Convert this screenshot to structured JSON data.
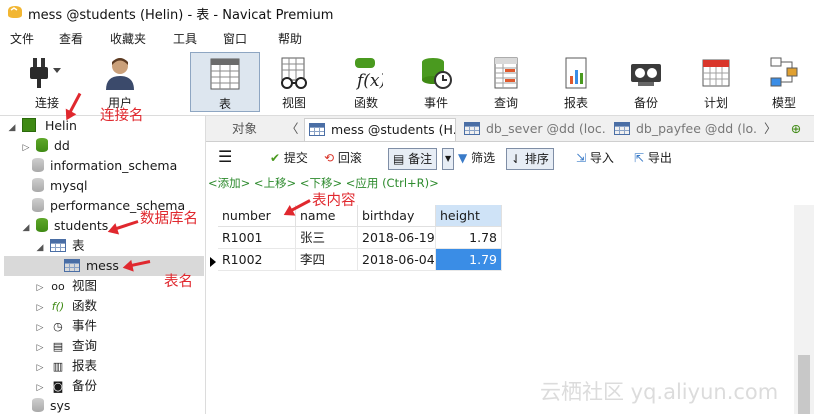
{
  "window": {
    "title": "mess @students (Helin) - 表 - Navicat Premium"
  },
  "menu": [
    "文件",
    "查看",
    "收藏夹",
    "工具",
    "窗口",
    "帮助"
  ],
  "toolbar": {
    "connect": "连接",
    "user": "用户",
    "table": "表",
    "view": "视图",
    "function": "函数",
    "event": "事件",
    "query": "查询",
    "report": "报表",
    "backup": "备份",
    "schedule": "计划",
    "model": "模型"
  },
  "tree": {
    "connection": "Helin",
    "databases": [
      "dd",
      "information_schema",
      "mysql",
      "performance_schema",
      "students"
    ],
    "tables_folder": "表",
    "table": "mess",
    "views": "视图",
    "functions": "函数",
    "events": "事件",
    "queries": "查询",
    "reports": "报表",
    "backups": "备份",
    "sys": "sys"
  },
  "tabs": {
    "objects": "对象",
    "tab1": "mess @students (H...",
    "tab2": "db_sever @dd (loc...",
    "tab3": "db_payfee @dd (lo..."
  },
  "subtoolbar": {
    "commit": "提交",
    "rollback": "回滚",
    "note": "备注",
    "filter": "筛选",
    "sort": "排序",
    "import": "导入",
    "export": "导出"
  },
  "hint": "<添加> <上移> <下移> <应用 (Ctrl+R)>",
  "grid": {
    "columns": [
      "number",
      "name",
      "birthday",
      "height"
    ],
    "rows": [
      [
        "R1001",
        "张三",
        "2018-06-19",
        "1.78"
      ],
      [
        "R1002",
        "李四",
        "2018-06-04",
        "1.79"
      ]
    ]
  },
  "annotations": {
    "connection_name": "连接名",
    "db_name": "数据库名",
    "table_content": "表内容",
    "table_name": "表名"
  },
  "watermark": "云栖社区 yq.aliyun.com",
  "colors": {
    "selection": "#3a8de6",
    "annotation": "#e0282e",
    "db_green": "#4a9a1f"
  }
}
